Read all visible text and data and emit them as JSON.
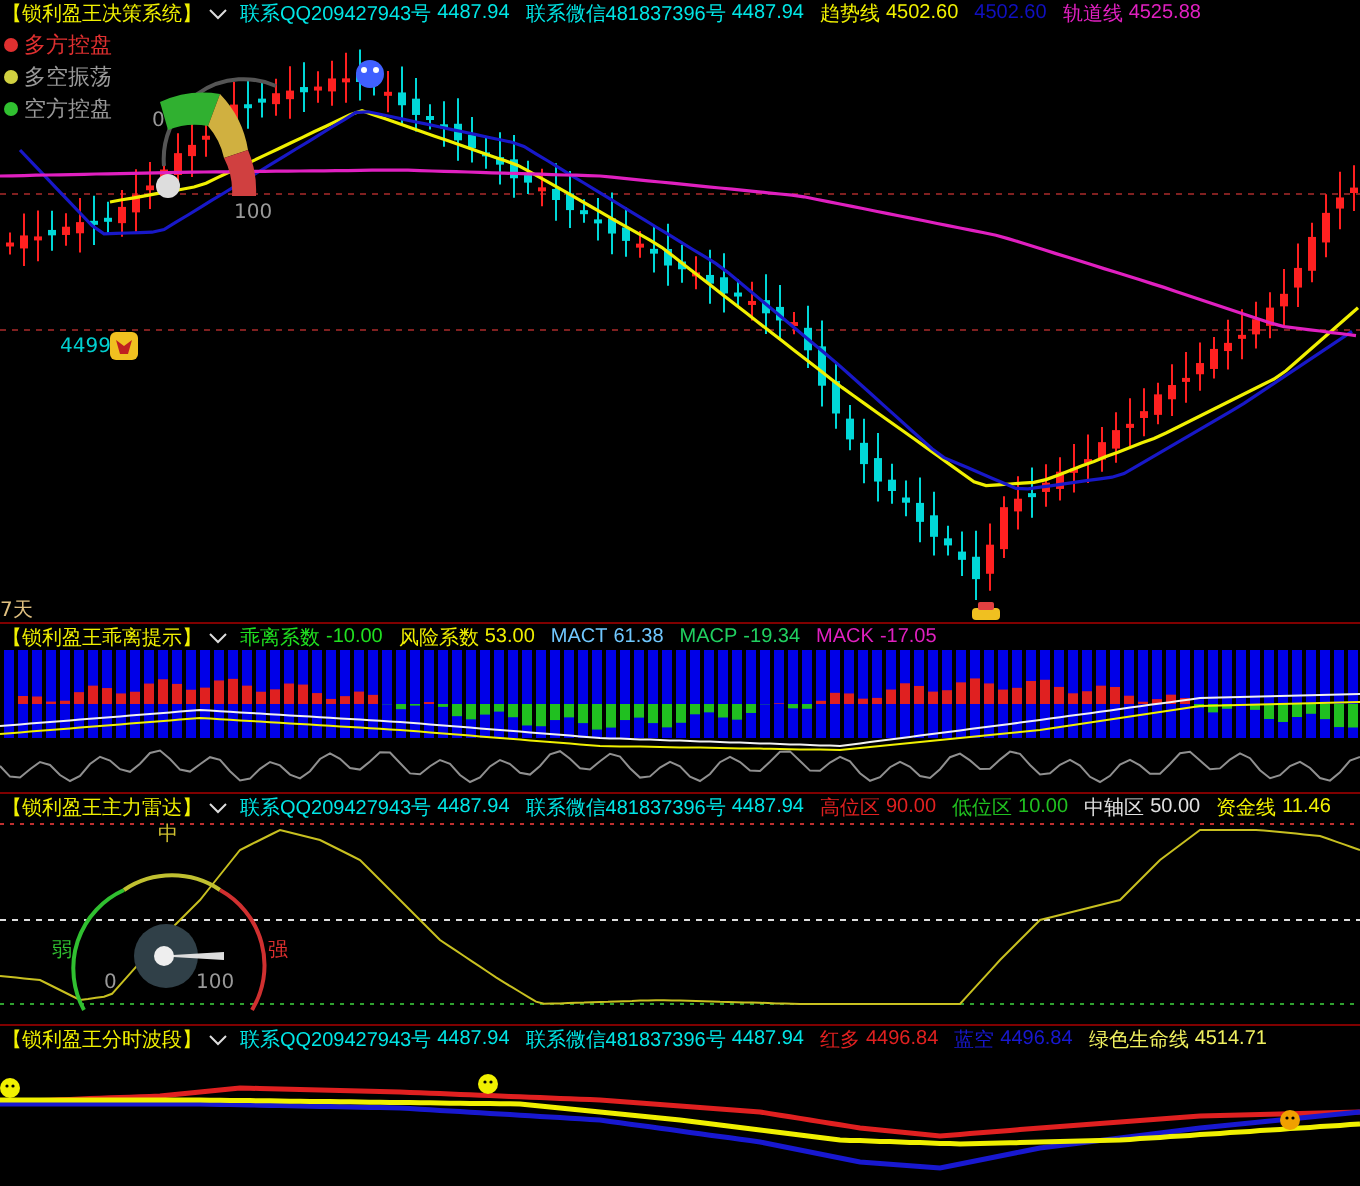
{
  "main_panel": {
    "title": "【锁利盈王决策系统】",
    "items": [
      {
        "label": "联系QQ209427943号",
        "value": "4487.94",
        "color": "#00e5e5"
      },
      {
        "label": "联系微信481837396号",
        "value": "4487.94",
        "color": "#00e5e5"
      },
      {
        "label": "趋势线",
        "value": "4502.60",
        "color": "#f0f000"
      },
      {
        "value": "4502.60",
        "color": "#1010c0"
      },
      {
        "label": "轨道线",
        "value": "4525.88",
        "color": "#e020c0"
      }
    ],
    "legend": [
      {
        "label": "多方控盘",
        "color": "#e03030"
      },
      {
        "label": "多空振荡",
        "color": "#d0d040"
      },
      {
        "label": "空方控盘",
        "color": "#30c030"
      }
    ],
    "gauge_labels": [
      "0",
      "100"
    ],
    "price_label": "4499",
    "period_label": "7天"
  },
  "deviation_panel": {
    "title": "【锁利盈王乖离提示】",
    "items": [
      {
        "label": "乖离系数",
        "value": "-10.00",
        "color": "#20e020"
      },
      {
        "label": "风险系数",
        "value": "53.00",
        "color": "#f0f000"
      },
      {
        "label": "MACT",
        "value": "61.38",
        "color": "#70c8ff"
      },
      {
        "label": "MACP",
        "value": "-19.34",
        "color": "#20d060"
      },
      {
        "label": "MACK",
        "value": "-17.05",
        "color": "#e020c0"
      }
    ]
  },
  "radar_panel": {
    "title": "【锁利盈王主力雷达】",
    "items": [
      {
        "label": "联系QQ209427943号",
        "value": "4487.94",
        "color": "#00e5e5"
      },
      {
        "label": "联系微信481837396号",
        "value": "4487.94",
        "color": "#00e5e5"
      },
      {
        "label": "高位区",
        "value": "90.00",
        "color": "#e02020"
      },
      {
        "label": "低位区",
        "value": "10.00",
        "color": "#20c020"
      },
      {
        "label": "中轴区",
        "value": "50.00",
        "color": "#e0e0e0"
      },
      {
        "label": "资金线",
        "value": "11.46",
        "color": "#f0f000"
      }
    ],
    "gauge_labels": {
      "middle": "中",
      "weak": "弱",
      "strong": "强",
      "low": "0",
      "high": "100"
    }
  },
  "wave_panel": {
    "title": "【锁利盈王分时波段】",
    "items": [
      {
        "label": "联系QQ209427943号",
        "value": "4487.94",
        "color": "#00e5e5"
      },
      {
        "label": "联系微信481837396号",
        "value": "4487.94",
        "color": "#00e5e5"
      },
      {
        "label": "红多",
        "value": "4496.84",
        "color": "#e02020"
      },
      {
        "label": "蓝空",
        "value": "4496.84",
        "color": "#1818d0"
      },
      {
        "label": "绿色生命线",
        "value": "4514.71",
        "color": "#f0f060"
      }
    ]
  }
}
